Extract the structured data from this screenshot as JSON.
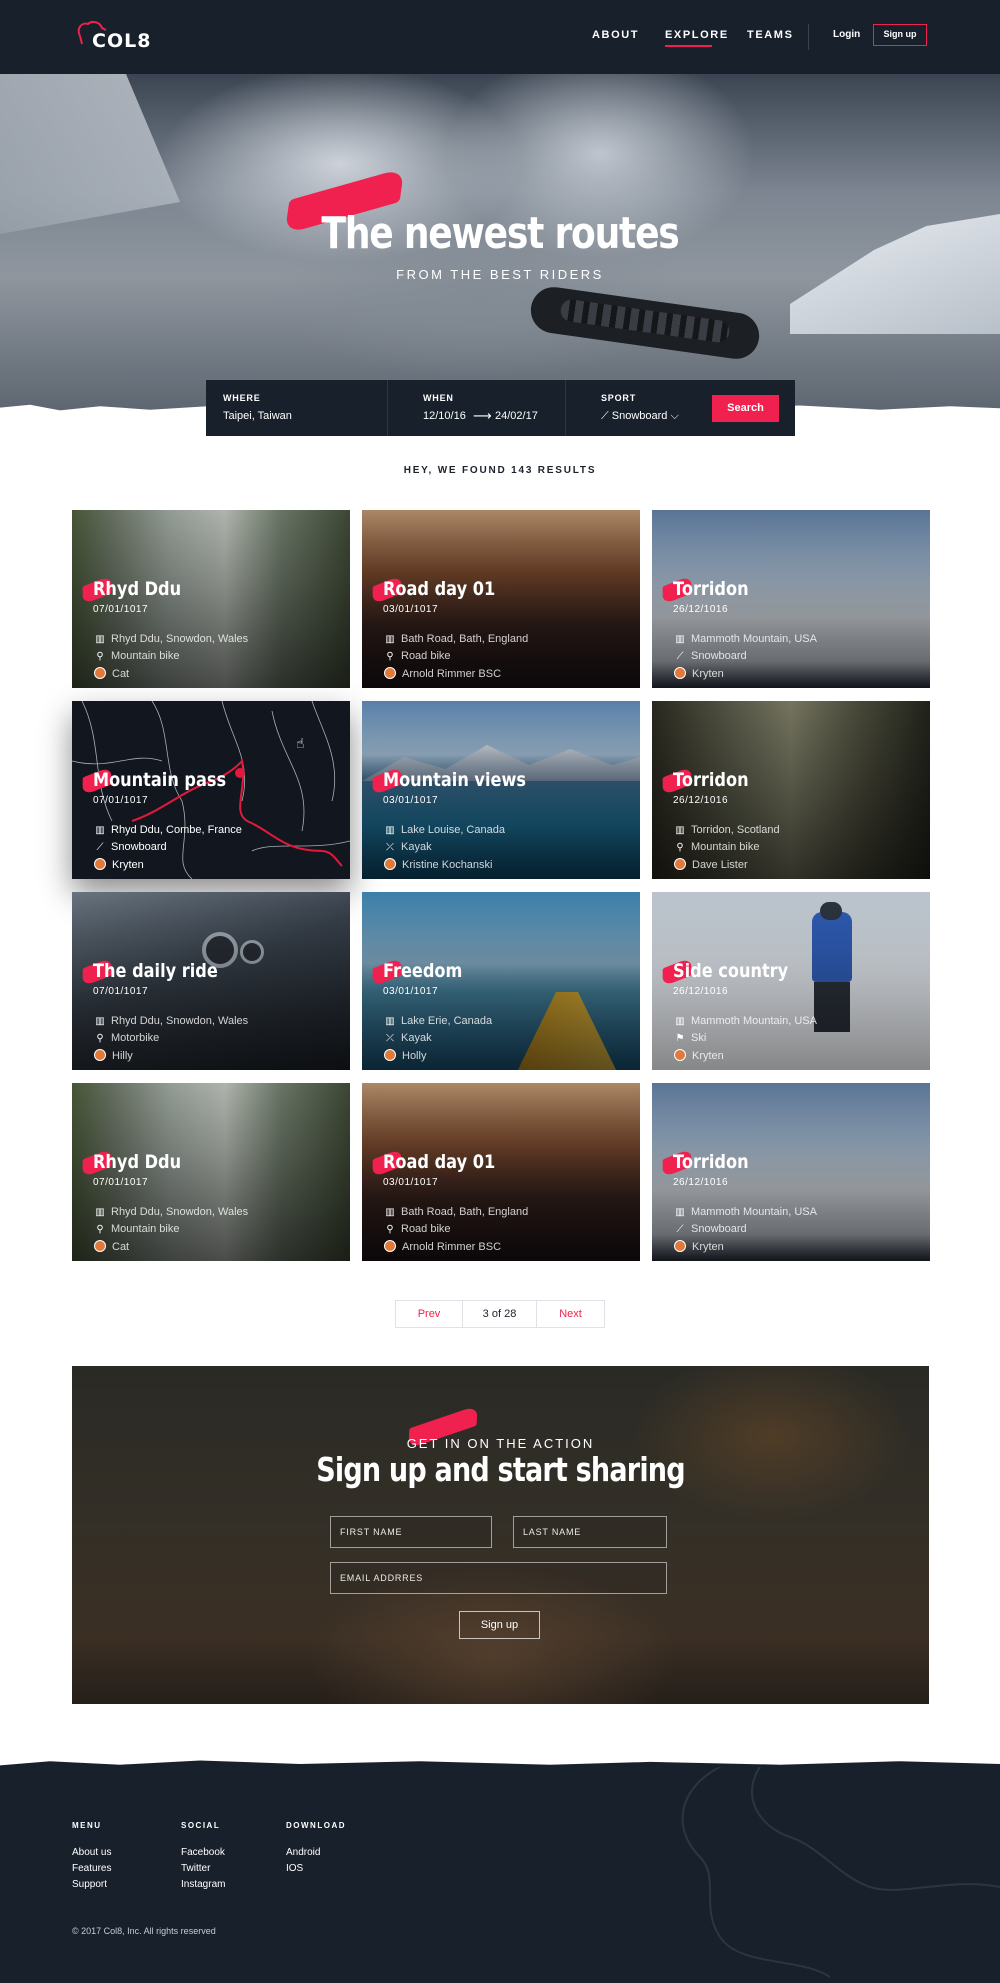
{
  "header": {
    "logo": "COL8",
    "nav": [
      "ABOUT",
      "EXPLORE",
      "TEAMS"
    ],
    "login": "Login",
    "signup": "Sign up"
  },
  "hero": {
    "title": "The newest routes",
    "subtitle": "FROM THE BEST RIDERS"
  },
  "search": {
    "where_label": "WHERE",
    "where_value": "Taipei, Taiwan",
    "when_label": "WHEN",
    "when_from": "12/10/16",
    "when_to": "24/02/17",
    "sport_label": "SPORT",
    "sport_value": "Snowboard",
    "button": "Search"
  },
  "results": {
    "heading": "HEY, WE FOUND 143 RESULTS",
    "cards": [
      {
        "title": "Rhyd Ddu",
        "date": "07/01/1017",
        "location": "Rhyd Ddu, Snowdon, Wales",
        "sport": "Mountain bike",
        "rider": "Cat"
      },
      {
        "title": "Road day 01",
        "date": "03/01/1017",
        "location": "Bath Road, Bath, England",
        "sport": "Road bike",
        "rider": "Arnold Rimmer BSC"
      },
      {
        "title": "Torridon",
        "date": "26/12/1016",
        "location": "Mammoth Mountain, USA",
        "sport": "Snowboard",
        "rider": "Kryten"
      },
      {
        "title": "Mountain pass",
        "date": "07/01/1017",
        "location": "Rhyd Ddu, Combe, France",
        "sport": "Snowboard",
        "rider": "Kryten"
      },
      {
        "title": "Mountain views",
        "date": "03/01/1017",
        "location": "Lake Louise, Canada",
        "sport": "Kayak",
        "rider": "Kristine Kochanski"
      },
      {
        "title": "Torridon",
        "date": "26/12/1016",
        "location": "Torridon, Scotland",
        "sport": "Mountain bike",
        "rider": "Dave Lister"
      },
      {
        "title": "The daily ride",
        "date": "07/01/1017",
        "location": "Rhyd Ddu, Snowdon, Wales",
        "sport": "Motorbike",
        "rider": "Hilly"
      },
      {
        "title": "Freedom",
        "date": "03/01/1017",
        "location": "Lake Erie, Canada",
        "sport": "Kayak",
        "rider": "Holly"
      },
      {
        "title": "Side country",
        "date": "26/12/1016",
        "location": "Mammoth Mountain, USA",
        "sport": "Ski",
        "rider": "Kryten"
      },
      {
        "title": "Rhyd Ddu",
        "date": "07/01/1017",
        "location": "Rhyd Ddu, Snowdon, Wales",
        "sport": "Mountain bike",
        "rider": "Cat"
      },
      {
        "title": "Road day 01",
        "date": "03/01/1017",
        "location": "Bath Road, Bath, England",
        "sport": "Road bike",
        "rider": "Arnold Rimmer BSC"
      },
      {
        "title": "Torridon",
        "date": "26/12/1016",
        "location": "Mammoth Mountain, USA",
        "sport": "Snowboard",
        "rider": "Kryten"
      }
    ]
  },
  "pagination": {
    "prev": "Prev",
    "current": "3 of 28",
    "next": "Next"
  },
  "signup_section": {
    "kicker": "GET IN ON THE ACTION",
    "title": "Sign up and start sharing",
    "first_name": "FIRST NAME",
    "last_name": "LAST NAME",
    "email": "EMAIL ADDRRES",
    "button": "Sign up"
  },
  "footer": {
    "menu_heading": "MENU",
    "menu_links": [
      "About us",
      "Features",
      "Support"
    ],
    "social_heading": "SOCIAL",
    "social_links": [
      "Facebook",
      "Twitter",
      "Instagram"
    ],
    "download_heading": "DOWNLOAD",
    "download_links": [
      "Android",
      "IOS"
    ],
    "copyright": "© 2017 Col8, Inc. All rights reserved"
  },
  "colors": {
    "accent": "#f0214e",
    "dark": "#18202b"
  }
}
